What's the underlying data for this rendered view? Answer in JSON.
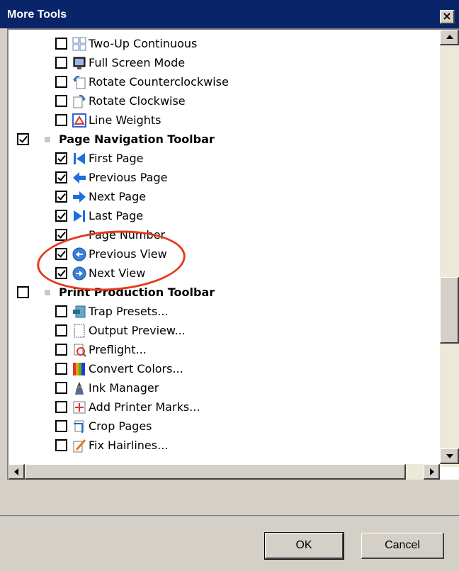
{
  "window": {
    "title": "More Tools",
    "close_glyph": "×"
  },
  "items": [
    {
      "label": "Two-Up Continuous",
      "checked": false,
      "level": 1,
      "icon": "two-up-continuous-icon"
    },
    {
      "label": "Full Screen Mode",
      "checked": false,
      "level": 1,
      "icon": "full-screen-icon"
    },
    {
      "label": "Rotate Counterclockwise",
      "checked": false,
      "level": 1,
      "icon": "rotate-ccw-icon"
    },
    {
      "label": "Rotate Clockwise",
      "checked": false,
      "level": 1,
      "icon": "rotate-cw-icon"
    },
    {
      "label": "Line Weights",
      "checked": false,
      "level": 1,
      "icon": "line-weights-icon"
    },
    {
      "label": "Page Navigation Toolbar",
      "checked": true,
      "level": 0,
      "icon": "bullet"
    },
    {
      "label": "First Page",
      "checked": true,
      "level": 1,
      "icon": "first-page-icon"
    },
    {
      "label": "Previous Page",
      "checked": true,
      "level": 1,
      "icon": "previous-page-icon"
    },
    {
      "label": "Next Page",
      "checked": true,
      "level": 1,
      "icon": "next-page-icon"
    },
    {
      "label": "Last Page",
      "checked": true,
      "level": 1,
      "icon": "last-page-icon"
    },
    {
      "label": "Page Number",
      "checked": true,
      "level": 1,
      "icon": "page-number-icon"
    },
    {
      "label": "Previous View",
      "checked": true,
      "level": 1,
      "icon": "previous-view-icon"
    },
    {
      "label": "Next View",
      "checked": true,
      "level": 1,
      "icon": "next-view-icon"
    },
    {
      "label": "Print Production Toolbar",
      "checked": false,
      "level": 0,
      "icon": "bullet"
    },
    {
      "label": "Trap Presets...",
      "checked": false,
      "level": 1,
      "icon": "trap-presets-icon"
    },
    {
      "label": "Output Preview...",
      "checked": false,
      "level": 1,
      "icon": "output-preview-icon"
    },
    {
      "label": "Preflight...",
      "checked": false,
      "level": 1,
      "icon": "preflight-icon"
    },
    {
      "label": "Convert Colors...",
      "checked": false,
      "level": 1,
      "icon": "convert-colors-icon"
    },
    {
      "label": "Ink Manager",
      "checked": false,
      "level": 1,
      "icon": "ink-manager-icon"
    },
    {
      "label": "Add Printer Marks...",
      "checked": false,
      "level": 1,
      "icon": "printer-marks-icon"
    },
    {
      "label": "Crop Pages",
      "checked": false,
      "level": 1,
      "icon": "crop-pages-icon"
    },
    {
      "label": "Fix Hairlines...",
      "checked": false,
      "level": 1,
      "icon": "fix-hairlines-icon"
    }
  ],
  "buttons": {
    "ok": "OK",
    "cancel": "Cancel"
  },
  "colors": {
    "titlebar": "#0a246a",
    "annotation": "#e8391b",
    "nav_blue": "#1e6fd9"
  }
}
